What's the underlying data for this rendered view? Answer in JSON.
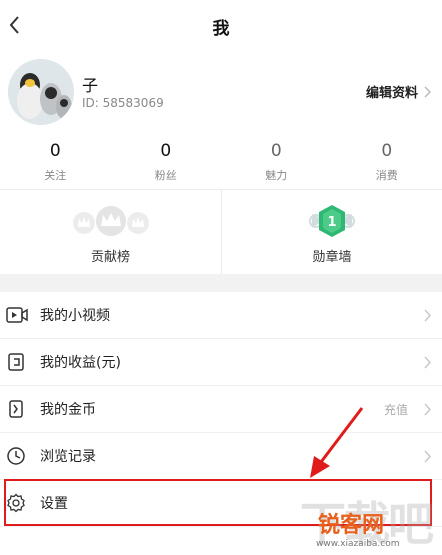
{
  "header": {
    "title": "我"
  },
  "profile": {
    "username": "子",
    "user_id": "ID: 58583069",
    "edit_label": "编辑资料"
  },
  "stats": [
    {
      "value": "0",
      "label": "关注"
    },
    {
      "value": "0",
      "label": "粉丝"
    },
    {
      "value": "0",
      "label": "魅力"
    },
    {
      "value": "0",
      "label": "消费"
    }
  ],
  "cards": [
    {
      "label": "贡献榜",
      "icon": "crown-rank-icon"
    },
    {
      "label": "勋章墙",
      "icon": "medal-icon",
      "badge_number": "1"
    }
  ],
  "menu": [
    {
      "label": "我的小视频",
      "icon": "video-icon",
      "extra": ""
    },
    {
      "label": "我的收益(元)",
      "icon": "wallet-icon",
      "extra": ""
    },
    {
      "label": "我的金币",
      "icon": "coin-icon",
      "extra": "充值"
    },
    {
      "label": "浏览记录",
      "icon": "clock-icon",
      "extra": ""
    },
    {
      "label": "设置",
      "icon": "gear-icon",
      "extra": ""
    }
  ],
  "annotation": {
    "highlight_color": "#e01b1b"
  },
  "watermark": {
    "brand": "锐客网",
    "url": "www.xiazaiba.com"
  },
  "colors": {
    "accent_green": "#2fb873",
    "divider": "#ececec",
    "section_gap": "#f2f2f2"
  }
}
